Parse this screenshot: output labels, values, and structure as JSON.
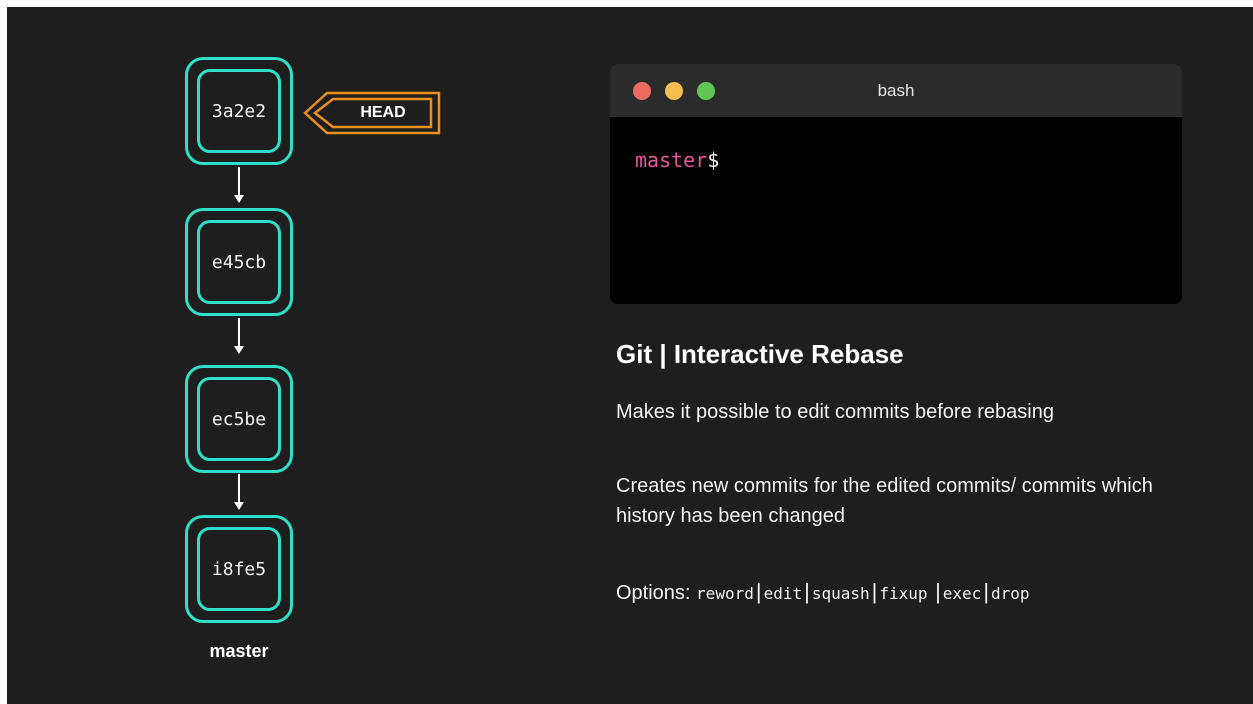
{
  "colors": {
    "background": "#1e1e1e",
    "commit_border": "#2fe0c8",
    "head_pointer": "#e8901b",
    "prompt_branch": "#e6589d"
  },
  "commits": [
    {
      "hash": "3a2e2"
    },
    {
      "hash": "e45cb"
    },
    {
      "hash": "ec5be"
    },
    {
      "hash": "i8fe5"
    }
  ],
  "branch_label": "master",
  "head_label": "HEAD",
  "terminal": {
    "title": "bash",
    "prompt_branch": "master",
    "prompt_symbol": "$"
  },
  "heading": "Git | Interactive Rebase",
  "paragraph_1": "Makes it possible to edit commits before rebasing",
  "paragraph_2": "Creates new commits for the edited commits/ commits which history has been changed",
  "options_label": "Options:",
  "options": [
    "reword",
    "edit",
    "squash",
    "fixup",
    "exec",
    "drop"
  ],
  "separator": "|"
}
